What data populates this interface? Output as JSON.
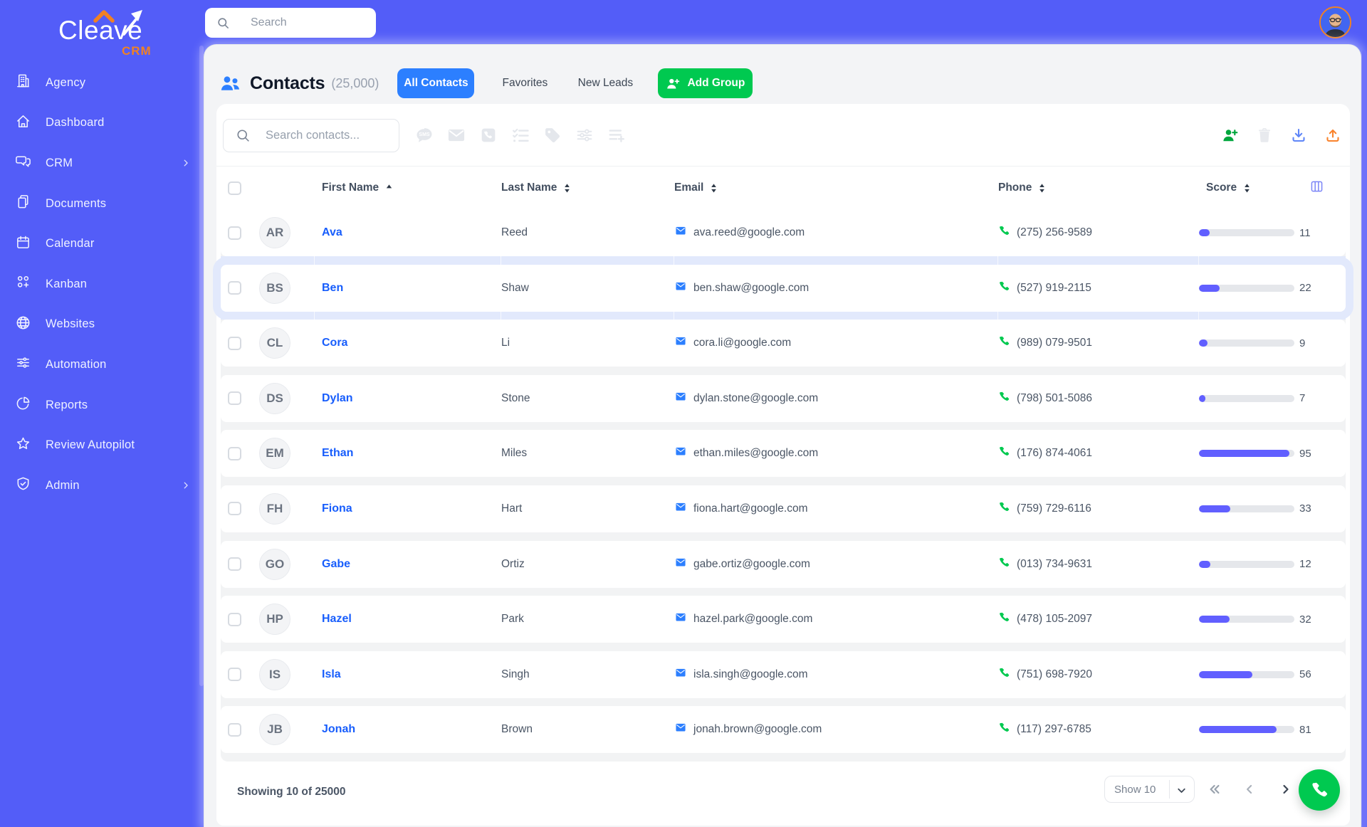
{
  "brand": {
    "name": "Cleave",
    "sub": "CRM"
  },
  "topbar": {
    "search_placeholder": "Search"
  },
  "sidebar": {
    "items": [
      {
        "label": "Agency",
        "icon": "building-icon",
        "chevron": false
      },
      {
        "label": "Dashboard",
        "icon": "home-icon",
        "chevron": false
      },
      {
        "label": "CRM",
        "icon": "chat-icon",
        "chevron": true
      },
      {
        "label": "Documents",
        "icon": "documents-icon",
        "chevron": false
      },
      {
        "label": "Calendar",
        "icon": "calendar-icon",
        "chevron": false
      },
      {
        "label": "Kanban",
        "icon": "kanban-icon",
        "chevron": false
      },
      {
        "label": "Websites",
        "icon": "globe-icon",
        "chevron": false
      },
      {
        "label": "Automation",
        "icon": "sliders-icon",
        "chevron": false
      },
      {
        "label": "Reports",
        "icon": "pie-chart-icon",
        "chevron": false
      },
      {
        "label": "Review Autopilot",
        "icon": "star-icon",
        "chevron": false
      },
      {
        "label": "Admin",
        "icon": "shield-icon",
        "chevron": true
      }
    ]
  },
  "header": {
    "title": "Contacts",
    "count": "(25,000)",
    "tab_all": "All Contacts",
    "tab_favorites": "Favorites",
    "tab_new_leads": "New Leads",
    "add_group_label": "Add Group"
  },
  "toolbar": {
    "search_placeholder": "Search contacts...",
    "bulk_icons": [
      "sms-icon",
      "email-icon",
      "call-icon",
      "checklist-icon",
      "tag-icon",
      "filters-icon",
      "add-to-list-icon"
    ],
    "action_icons": [
      "add-contact-icon",
      "delete-icon",
      "download-icon",
      "upload-icon"
    ]
  },
  "table": {
    "columns": [
      {
        "label": "First Name",
        "sort": "asc"
      },
      {
        "label": "Last Name",
        "sort": "both"
      },
      {
        "label": "Email",
        "sort": "both"
      },
      {
        "label": "Phone",
        "sort": "both"
      },
      {
        "label": "Score",
        "sort": "both"
      }
    ],
    "rows": [
      {
        "initials": "AR",
        "first": "Ava",
        "last": "Reed",
        "email": "ava.reed@google.com",
        "phone": "(275) 256-9589",
        "score": 11,
        "highlighted": false
      },
      {
        "initials": "BS",
        "first": "Ben",
        "last": "Shaw",
        "email": "ben.shaw@google.com",
        "phone": "(527) 919-2115",
        "score": 22,
        "highlighted": true
      },
      {
        "initials": "CL",
        "first": "Cora",
        "last": "Li",
        "email": "cora.li@google.com",
        "phone": "(989) 079-9501",
        "score": 9,
        "highlighted": false
      },
      {
        "initials": "DS",
        "first": "Dylan",
        "last": "Stone",
        "email": "dylan.stone@google.com",
        "phone": "(798) 501-5086",
        "score": 7,
        "highlighted": false
      },
      {
        "initials": "EM",
        "first": "Ethan",
        "last": "Miles",
        "email": "ethan.miles@google.com",
        "phone": "(176) 874-4061",
        "score": 95,
        "highlighted": false
      },
      {
        "initials": "FH",
        "first": "Fiona",
        "last": "Hart",
        "email": "fiona.hart@google.com",
        "phone": "(759) 729-6116",
        "score": 33,
        "highlighted": false
      },
      {
        "initials": "GO",
        "first": "Gabe",
        "last": "Ortiz",
        "email": "gabe.ortiz@google.com",
        "phone": "(013) 734-9631",
        "score": 12,
        "highlighted": false
      },
      {
        "initials": "HP",
        "first": "Hazel",
        "last": "Park",
        "email": "hazel.park@google.com",
        "phone": "(478) 105-2097",
        "score": 32,
        "highlighted": false
      },
      {
        "initials": "IS",
        "first": "Isla",
        "last": "Singh",
        "email": "isla.singh@google.com",
        "phone": "(751) 698-7920",
        "score": 56,
        "highlighted": false
      },
      {
        "initials": "JB",
        "first": "Jonah",
        "last": "Brown",
        "email": "jonah.brown@google.com",
        "phone": "(117) 297-6785",
        "score": 81,
        "highlighted": false
      }
    ]
  },
  "footer": {
    "showing": "Showing 10 of 25000",
    "page_size_label": "Show 10"
  },
  "colors": {
    "sidebar": "#535df8",
    "panel_bg": "#f3f4f6",
    "accent_blue": "#2c7fff",
    "green": "#00c950",
    "score_fill": "#615fff",
    "name_link": "#175dfc",
    "logo_orange": "#f08124"
  }
}
